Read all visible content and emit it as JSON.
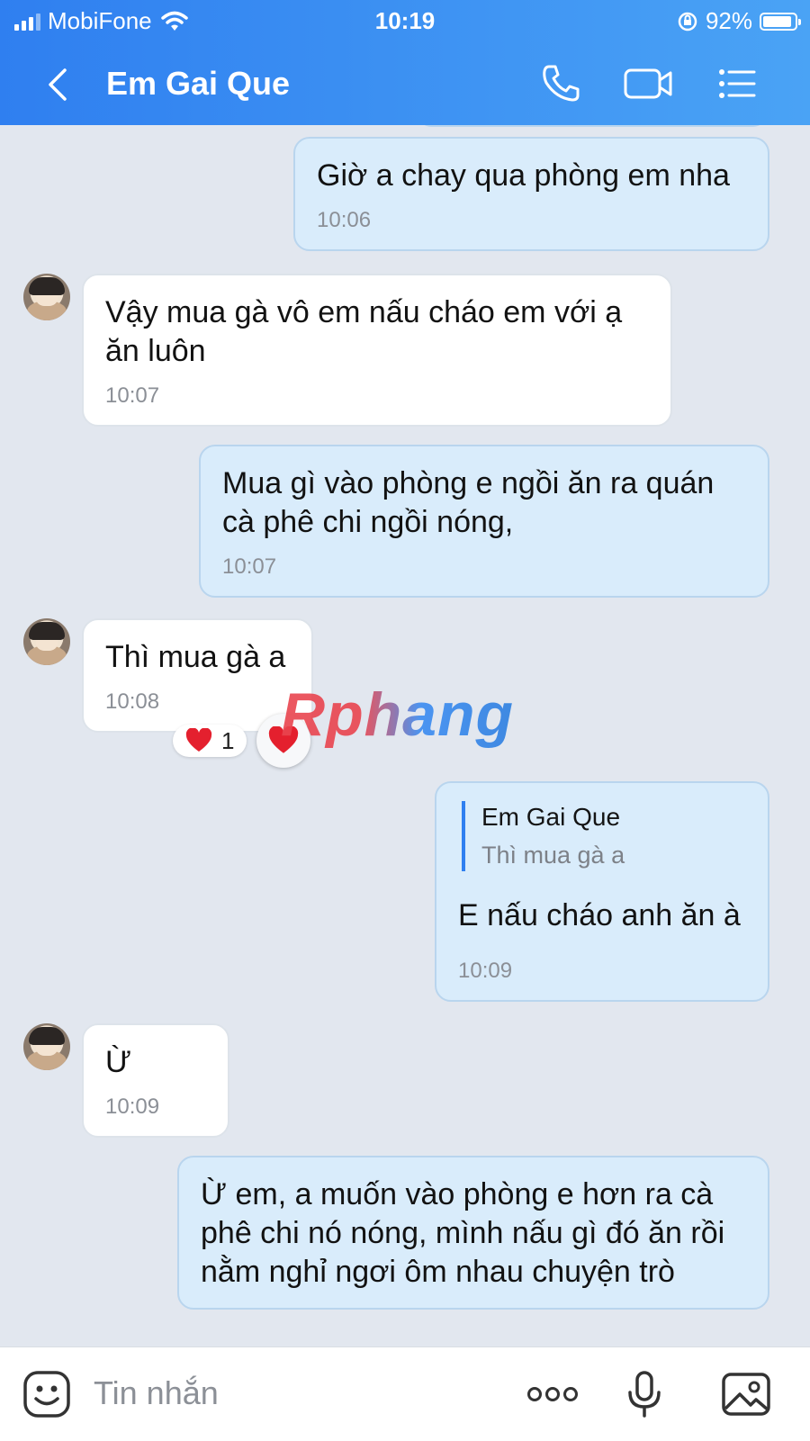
{
  "status_bar": {
    "carrier": "MobiFone",
    "time": "10:19",
    "battery": "92%",
    "battery_level": 0.92
  },
  "header": {
    "title": "Em Gai Que"
  },
  "messages": [
    {
      "from": "me",
      "text": "Giờ a chay qua phòng em nha",
      "time": "10:06"
    },
    {
      "from": "them",
      "text": "Vậy mua gà vô em nấu cháo em với ạ ăn luôn",
      "time": "10:07"
    },
    {
      "from": "me",
      "text": "Mua gì vào phòng e ngồi ăn ra quán cà phê chi ngồi nóng,",
      "time": "10:07"
    },
    {
      "from": "them",
      "text": "Thì mua gà a",
      "time": "10:08",
      "reaction_count": "1"
    },
    {
      "from": "me",
      "quote_name": "Em Gai Que",
      "quote_text": "Thì mua gà a",
      "text": "E nấu cháo anh ăn à",
      "time": "10:09"
    },
    {
      "from": "them",
      "text": "Ừ",
      "time": "10:09"
    },
    {
      "from": "me",
      "text": "Ừ em, a muốn vào phòng e hơn ra cà phê chi nó nóng, mình nấu gì đó ăn rồi nằm nghỉ ngơi ôm nhau chuyện trò"
    }
  ],
  "watermark": "Rphang",
  "input": {
    "placeholder": "Tin nhắn"
  },
  "icons": [
    "back-icon",
    "phone-icon",
    "video-call-icon",
    "menu-icon",
    "emoji-icon",
    "more-icon",
    "microphone-icon",
    "image-icon",
    "heart-icon"
  ],
  "colors": {
    "header_start": "#2f7ff0",
    "header_end": "#4aa3f5",
    "mine_bubble": "#d9ecfb",
    "theirs_bubble": "#ffffff",
    "background": "#e2e7ef"
  }
}
